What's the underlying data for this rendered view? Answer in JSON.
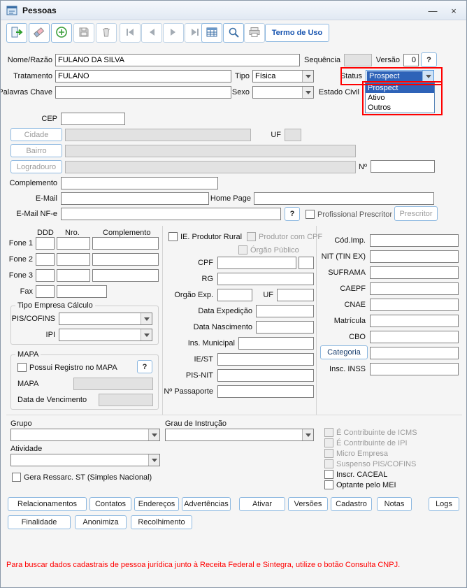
{
  "window": {
    "title": "Pessoas",
    "minimize_glyph": "—",
    "close_glyph": "×"
  },
  "toolbar": {
    "termo_de_uso": "Termo de Uso"
  },
  "help_glyph": "?",
  "person": {
    "nome_razao": {
      "label": "Nome/Razão",
      "value": "FULANO DA SILVA"
    },
    "sequencia": {
      "label": "Sequência",
      "value": ""
    },
    "versao": {
      "label": "Versão",
      "value": "0"
    },
    "tratamento": {
      "label": "Tratamento",
      "value": "FULANO"
    },
    "tipo": {
      "label": "Tipo",
      "value": "Física"
    },
    "status": {
      "label": "Status",
      "value": "Prospect",
      "options": [
        "Prospect",
        "Ativo",
        "Outros"
      ]
    },
    "palavras_chave": {
      "label": "Palavras Chave",
      "value": ""
    },
    "sexo": {
      "label": "Sexo",
      "value": ""
    },
    "estado_civil": {
      "label": "Estado Civil"
    }
  },
  "address": {
    "cep_label": "CEP",
    "cidade_button": "Cidade",
    "uf_label": "UF",
    "bairro_button": "Bairro",
    "logradouro_button": "Logradouro",
    "numero_label": "Nº",
    "complemento_label": "Complemento",
    "email_label": "E-Mail",
    "homepage_label": "Home Page",
    "email_nfe_label": "E-Mail NF-e",
    "profissional_prescritor_label": "Profissional Prescritor",
    "prescritor_button": "Prescritor"
  },
  "phones": {
    "ddd_header": "DDD",
    "nro_header": "Nro.",
    "complemento_header": "Complemento",
    "fone1_label": "Fone 1",
    "fone2_label": "Fone 2",
    "fone3_label": "Fone 3",
    "fax_label": "Fax"
  },
  "tipo_empresa": {
    "legend": "Tipo Empresa Cálculo",
    "pis_cofins_label": "PIS/COFINS",
    "ipi_label": "IPI"
  },
  "mapa": {
    "legend": "MAPA",
    "possui_registro_label": "Possui Registro no MAPA",
    "mapa_label": "MAPA",
    "data_vencimento_label": "Data de Vencimento"
  },
  "docs": {
    "ie_produtor_rural_label": "IE. Produtor Rural",
    "produtor_com_cpf_label": "Produtor com CPF",
    "orgao_publico_label": "Órgão Público",
    "cpf_label": "CPF",
    "rg_label": "RG",
    "orgao_exp_label": "Orgão Exp.",
    "uf_label": "UF",
    "data_expedicao_label": "Data Expedição",
    "data_nascimento_label": "Data Nascimento",
    "ins_municipal_label": "Ins. Municipal",
    "ie_st_label": "IE/ST",
    "pis_nit_label": "PIS-NIT",
    "passaporte_label": "Nº Passaporte"
  },
  "fiscal": {
    "cod_imp_label": "Cód.Imp.",
    "nit_label": "NIT (TIN EX)",
    "suframa_label": "SUFRAMA",
    "caepf_label": "CAEPF",
    "cnae_label": "CNAE",
    "matricula_label": "Matrícula",
    "cbo_label": "CBO",
    "categoria_button": "Categoria",
    "insc_inss_label": "Insc. INSS"
  },
  "classification": {
    "grupo_label": "Grupo",
    "grau_instrucao_label": "Grau de Instrução",
    "atividade_label": "Atividade",
    "gera_ressarc_label": "Gera Ressarc. ST (Simples Nacional)",
    "checks": [
      "É Contribuinte de ICMS",
      "É Contribuinte de IPI",
      "Micro Empresa",
      "Suspenso PIS/COFINS",
      "Inscr. CACEAL",
      "Optante pelo MEI"
    ]
  },
  "actions": {
    "row1": [
      "Relacionamentos",
      "Contatos",
      "Endereços",
      "Advertências",
      "Ativar",
      "Versões",
      "Cadastro",
      "Notas",
      "Logs"
    ],
    "row2": [
      "Finalidade",
      "Anonimiza",
      "Recolhimento"
    ]
  },
  "footer": {
    "warning": "Para buscar dados cadastrais de pessoa jurídica junto à Receita Federal e Sintegra, utilize o botão Consulta CNPJ."
  },
  "colors": {
    "accent_border": "#8db8e0",
    "selection_blue": "#2e63b8",
    "highlight_red": "#ff0000"
  }
}
